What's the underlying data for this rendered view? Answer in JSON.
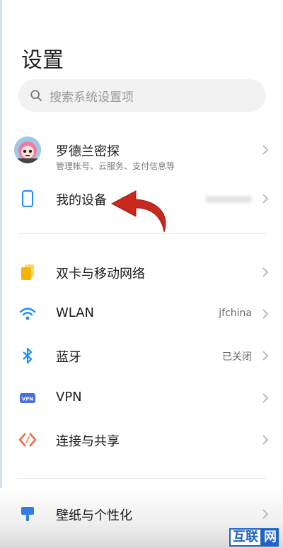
{
  "page": {
    "title": "设置"
  },
  "search": {
    "placeholder": "搜索系统设置项",
    "icon": "search-icon"
  },
  "account": {
    "name": "罗德兰密探",
    "subtitle": "管理帐号、云服务、支付信息等"
  },
  "items": [
    {
      "label": "我的设备",
      "value": "",
      "icon": "phone-icon",
      "color": "#1a8cff"
    },
    {
      "label": "双卡与移动网络",
      "value": "",
      "icon": "sim-card-icon",
      "color": "#f5b400"
    },
    {
      "label": "WLAN",
      "value": "jfchina",
      "icon": "wifi-icon",
      "color": "#1a8cff"
    },
    {
      "label": "蓝牙",
      "value": "已关闭",
      "icon": "bluetooth-icon",
      "color": "#1a8cff"
    },
    {
      "label": "VPN",
      "value": "",
      "icon": "vpn-icon",
      "color": "#4a6ee0"
    },
    {
      "label": "连接与共享",
      "value": "",
      "icon": "share-icon",
      "color": "#f06a45"
    },
    {
      "label": "壁纸与个性化",
      "value": "",
      "icon": "brush-icon",
      "color": "#2f7fe6"
    }
  ],
  "watermark": {
    "part1": "互联",
    "part2": "网"
  },
  "annotation": {
    "arrow_color": "#c8281e"
  }
}
